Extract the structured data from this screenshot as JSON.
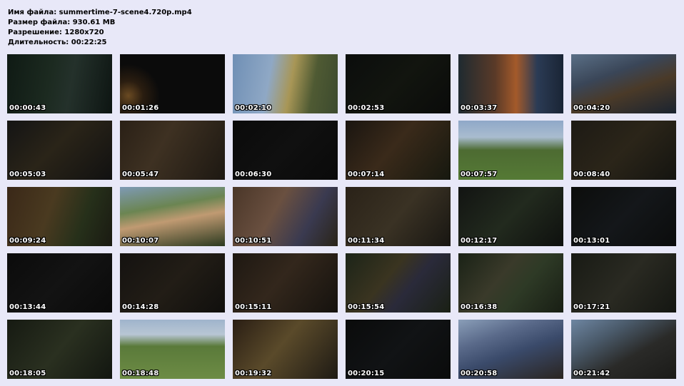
{
  "info": {
    "filename_line": "Имя файла: summertime-7-scene4.720p.mp4",
    "filesize_line": "Размер файла: 930.61 MB",
    "resolution_line": "Разрешение: 1280x720",
    "duration_line": "Длительность: 00:22:25"
  },
  "thumbnails": [
    {
      "time": "00:00:43",
      "bg": "linear-gradient(100deg,#0f1a14 0%,#1c2a20 40%,#24312b 60%,#0d1512 100%)"
    },
    {
      "time": "00:01:26",
      "bg": "radial-gradient(circle at 8% 70%,#6a4a22 0,#2a1d10 14%,#0b0b0b 30%)"
    },
    {
      "time": "00:02:10",
      "bg": "linear-gradient(100deg,#6f8fb5 0%,#8fa8c5 35%,#a89656 55%,#4f5a33 75%,#3c4a2e 100%)"
    },
    {
      "time": "00:02:53",
      "bg": "linear-gradient(135deg,#0b0d0c 0%,#12150f 50%,#0a0b0a 100%)"
    },
    {
      "time": "00:03:37",
      "bg": "linear-gradient(90deg,#1f2a30 0%,#5a3a28 35%,#a45a2a 55%,#2b3b55 75%,#1a2535 100%)"
    },
    {
      "time": "00:04:20",
      "bg": "linear-gradient(160deg,#5a6f86 0%,#3a4658 35%,#4a3a28 60%,#1a2330 100%)"
    },
    {
      "time": "00:05:03",
      "bg": "linear-gradient(135deg,#141414 0%,#2a2418 45%,#111 100%)"
    },
    {
      "time": "00:05:47",
      "bg": "linear-gradient(120deg,#2a2016 0%,#3e3122 40%,#1d1812 100%)"
    },
    {
      "time": "00:06:30",
      "bg": "linear-gradient(135deg,#0a0a0a 0%,#101010 50%,#0a0a0a 100%)"
    },
    {
      "time": "00:07:14",
      "bg": "linear-gradient(130deg,#1a1510 0%,#3a2a1a 45%,#16180f 100%)"
    },
    {
      "time": "00:07:57",
      "bg": "linear-gradient(180deg,#8fa8c8 0%,#a9bccf 28%,#4d6b32 50%,#557a35 100%)"
    },
    {
      "time": "00:08:40",
      "bg": "linear-gradient(135deg,#1d1a14 0%,#2b2519 50%,#141410 100%)"
    },
    {
      "time": "00:09:24",
      "bg": "linear-gradient(110deg,#3a2818 0%,#4a3a20 40%,#26301a 70%,#1a1a12 100%)"
    },
    {
      "time": "00:10:07",
      "bg": "linear-gradient(170deg,#7e9ab5 0%,#6b8552 35%,#c09a72 55%,#2c3a20 100%)"
    },
    {
      "time": "00:10:51",
      "bg": "linear-gradient(120deg,#4a3628 0%,#6a5040 40%,#3a3a50 70%,#2a2418 100%)"
    },
    {
      "time": "00:11:34",
      "bg": "linear-gradient(130deg,#2a2218 0%,#3a3224 50%,#181612 100%)"
    },
    {
      "time": "00:12:17",
      "bg": "linear-gradient(135deg,#121412 0%,#222a1e 50%,#0e100e 100%)"
    },
    {
      "time": "00:13:01",
      "bg": "linear-gradient(135deg,#0c0d0c 0%,#14171a 50%,#0b0c0c 100%)"
    },
    {
      "time": "00:13:44",
      "bg": "linear-gradient(135deg,#0b0b0b 0%,#131313 50%,#0a0a0a 100%)"
    },
    {
      "time": "00:14:28",
      "bg": "linear-gradient(135deg,#141210 0%,#221d16 50%,#100f0d 100%)"
    },
    {
      "time": "00:15:11",
      "bg": "linear-gradient(130deg,#1e1812 0%,#33271c 45%,#15120e 100%)"
    },
    {
      "time": "00:15:54",
      "bg": "linear-gradient(130deg,#1c2418 0%,#3a3420 40%,#2a2a3a 60%,#1a2014 100%)"
    },
    {
      "time": "00:16:38",
      "bg": "linear-gradient(130deg,#1a2216 0%,#3a3a2a 40%,#2e3a26 60%,#181e14 100%)"
    },
    {
      "time": "00:17:21",
      "bg": "linear-gradient(130deg,#181a14 0%,#2a2a22 50%,#141612 100%)"
    },
    {
      "time": "00:18:05",
      "bg": "linear-gradient(130deg,#161a12 0%,#2a3020 50%,#121610 100%)"
    },
    {
      "time": "00:18:48",
      "bg": "linear-gradient(180deg,#9fb4cc 0%,#b8c6d4 25%,#5a7a3a 45%,#6d8c45 100%)"
    },
    {
      "time": "00:19:32",
      "bg": "linear-gradient(130deg,#2a1e14 0%,#5a4a2a 45%,#1e1a14 100%)"
    },
    {
      "time": "00:20:15",
      "bg": "linear-gradient(135deg,#0a0b0b 0%,#111315 50%,#0a0b0b 100%)"
    },
    {
      "time": "00:20:58",
      "bg": "linear-gradient(160deg,#8a9eb8 0%,#5a6a8a 30%,#3a4a6a 55%,#2a2420 100%)"
    },
    {
      "time": "00:21:42",
      "bg": "linear-gradient(150deg,#6e86a2 0%,#4a5a6a 30%,#2a2a28 60%,#1a1a18 100%)"
    }
  ]
}
